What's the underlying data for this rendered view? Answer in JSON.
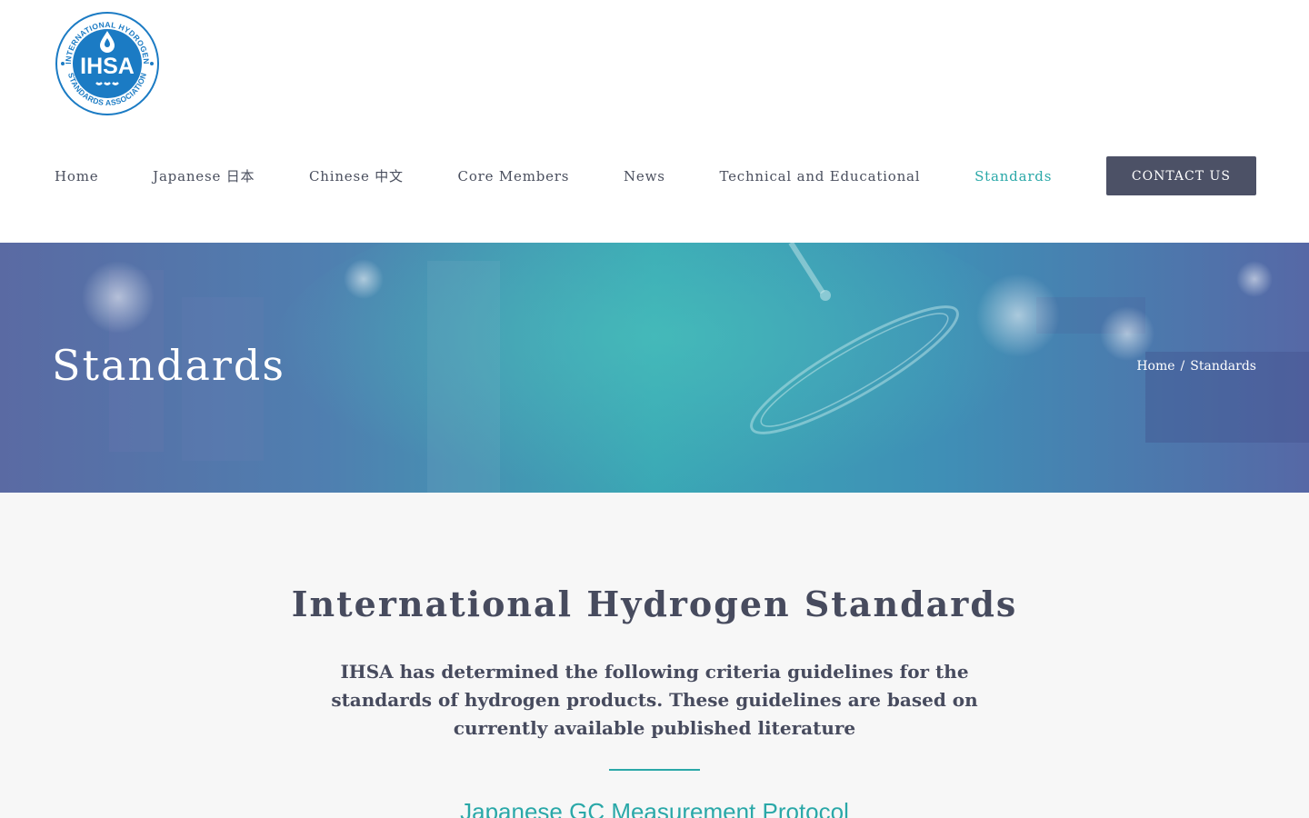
{
  "logo": {
    "acronym": "IHSA",
    "ring_text_top": "INTERNATIONAL HYDROGEN",
    "ring_text_bottom": "STANDARDS ASSOCIATION",
    "color": "#1b7bc4"
  },
  "nav": {
    "items": [
      {
        "label": "Home"
      },
      {
        "label": "Japanese 日本"
      },
      {
        "label": "Chinese 中文"
      },
      {
        "label": "Core Members"
      },
      {
        "label": "News"
      },
      {
        "label": "Technical and Educational"
      },
      {
        "label": "Standards",
        "active": true
      }
    ],
    "contact_label": "CONTACT US"
  },
  "banner": {
    "title": "Standards",
    "breadcrumb": {
      "home": "Home",
      "separator": "/",
      "current": "Standards"
    }
  },
  "main": {
    "heading": "International Hydrogen Standards",
    "intro": "IHSA has determined the following criteria guidelines for the standards of hydrogen products. These guidelines are based on currently available published literature",
    "section_link": "Japanese GC Measurement Protocol"
  },
  "colors": {
    "accent": "#2aa8a8",
    "text_dark": "#474b5e",
    "button_bg": "#4c5166",
    "page_bg": "#f7f7f7"
  }
}
